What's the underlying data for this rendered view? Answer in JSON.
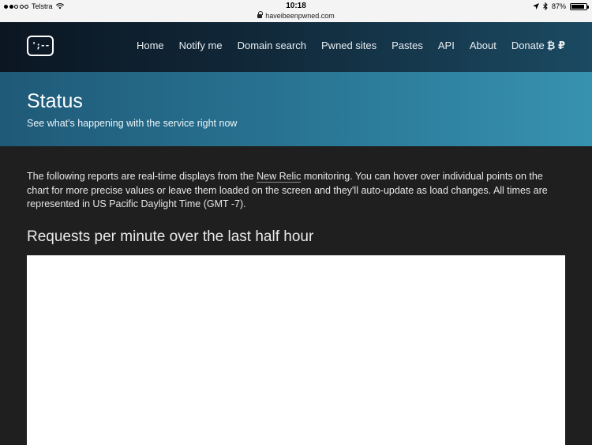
{
  "status_bar": {
    "carrier": "Telstra",
    "time": "10:18",
    "url": "haveibeenpwned.com",
    "battery": "87%",
    "battery_level": 0.87
  },
  "nav": {
    "logo_text": "';--",
    "items": [
      "Home",
      "Notify me",
      "Domain search",
      "Pwned sites",
      "Pastes",
      "API",
      "About"
    ],
    "donate_label": "Donate",
    "donate_symbols": "₿ ₽"
  },
  "header": {
    "title": "Status",
    "subtitle": "See what's happening with the service right now"
  },
  "intro": {
    "before_link": "The following reports are real-time displays from the ",
    "link_text": "New Relic",
    "after_link": " monitoring. You can hover over individual points on the chart for more precise values or leave them loaded on the screen and they'll auto-update as load changes. All times are represented in US Pacific Daylight Time (GMT -7)."
  },
  "section": {
    "title": "Requests per minute over the last half hour"
  }
}
